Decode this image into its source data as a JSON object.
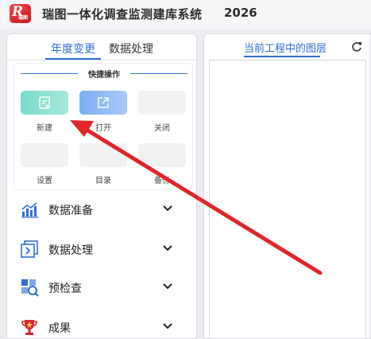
{
  "app": {
    "logo_text": "R",
    "logo_sub": "瑞图",
    "title": "瑞图一体化调查监测建库系统",
    "year": "2026"
  },
  "left_panel": {
    "tabs": [
      {
        "label": "年度变更",
        "active": true
      },
      {
        "label": "数据处理",
        "active": false
      }
    ],
    "quick_ops": {
      "title": "快捷操作",
      "buttons": [
        {
          "label": "新建",
          "icon": "new-doc-icon",
          "color": "#8fe0d2"
        },
        {
          "label": "打开",
          "icon": "open-external-icon",
          "color": "#93bcf4"
        },
        {
          "label": "关闭",
          "icon": "",
          "color": "#f1f2f4"
        },
        {
          "label": "设置",
          "icon": "",
          "color": "#f1f2f4"
        },
        {
          "label": "目录",
          "icon": "",
          "color": "#f1f2f4"
        },
        {
          "label": "备份",
          "icon": "",
          "color": "#f1f2f4"
        }
      ]
    },
    "menu": [
      {
        "label": "数据准备",
        "icon": "bar-chart-icon"
      },
      {
        "label": "数据处理",
        "icon": "data-process-icon"
      },
      {
        "label": "预检查",
        "icon": "inspect-icon"
      },
      {
        "label": "成果",
        "icon": "trophy-icon"
      }
    ]
  },
  "right_panel": {
    "tab": "当前工程中的图层",
    "refresh_icon": "refresh-icon"
  },
  "colors": {
    "accent": "#2f6fd1",
    "annotation_arrow": "#e0262b"
  }
}
